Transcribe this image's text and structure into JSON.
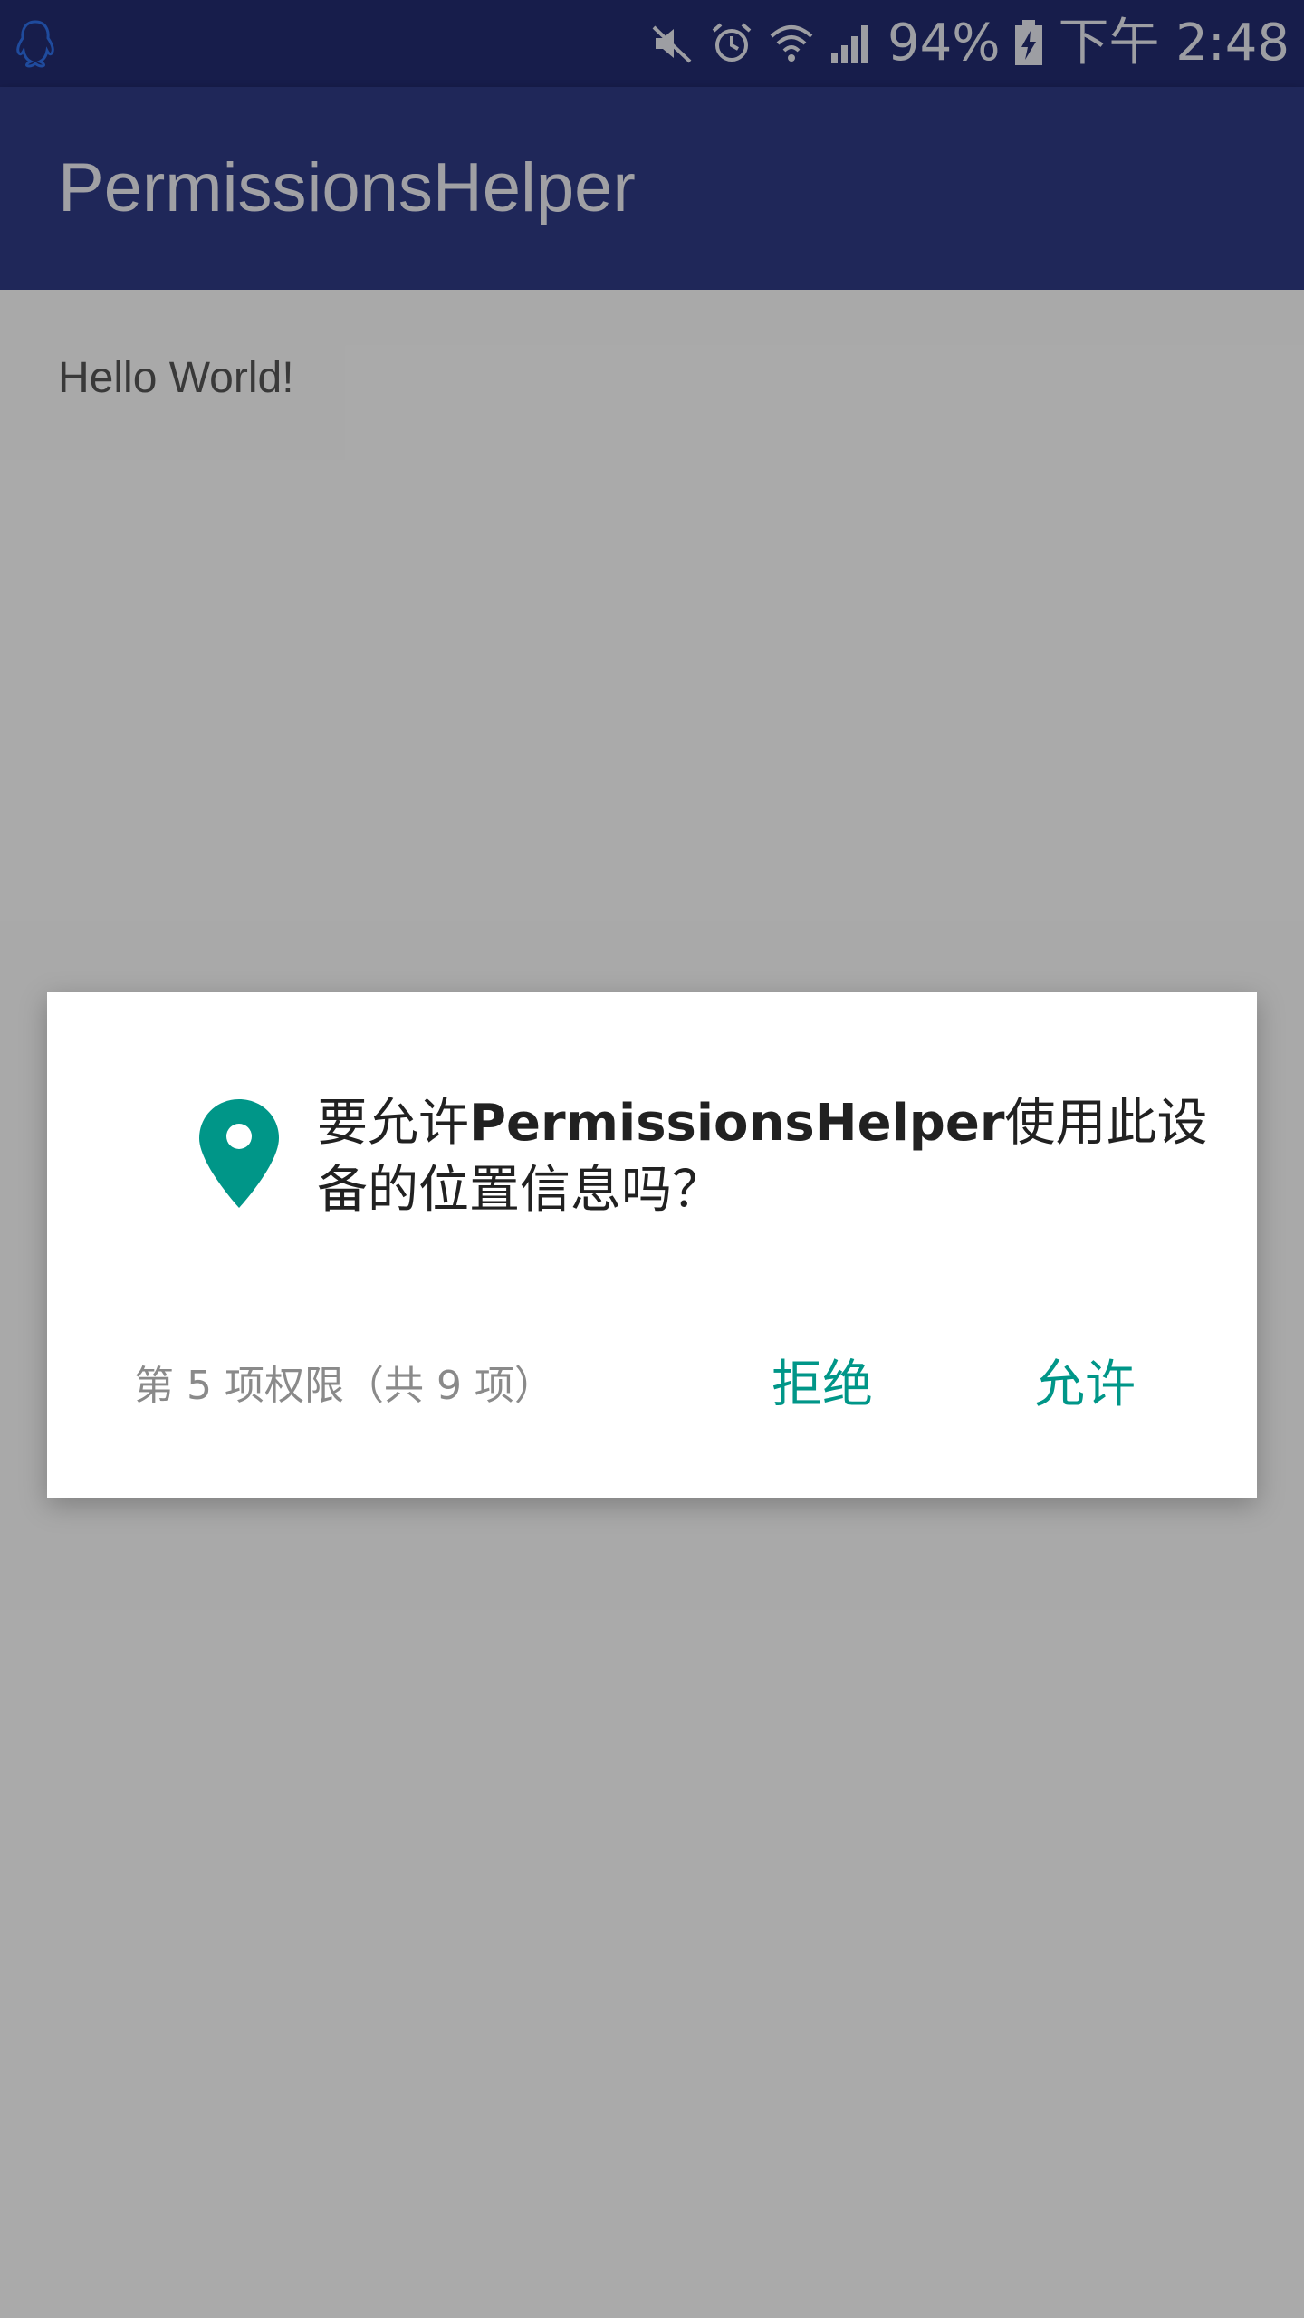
{
  "status_bar": {
    "notification_icon": "qq-penguin-icon",
    "icons": [
      "mute-icon",
      "alarm-icon",
      "wifi-icon",
      "signal-icon",
      "battery-charging-icon"
    ],
    "battery_percent": "94%",
    "time": "下午 2:48"
  },
  "app_bar": {
    "title": "PermissionsHelper"
  },
  "main": {
    "text": "Hello World!"
  },
  "dialog": {
    "icon": "location-pin-icon",
    "message_prefix": "要允许",
    "app_name": "PermissionsHelper",
    "message_suffix": "使用此设备的位置信息吗？",
    "counter": "第 5 项权限（共 9 项）",
    "deny_label": "拒绝",
    "allow_label": "允许"
  },
  "colors": {
    "status_bar": "#222b6f",
    "app_bar": "#2e3a84",
    "accent": "#009688",
    "scrim": "rgba(0,0,0,0.32)",
    "dialog_background": "#ffffff"
  }
}
